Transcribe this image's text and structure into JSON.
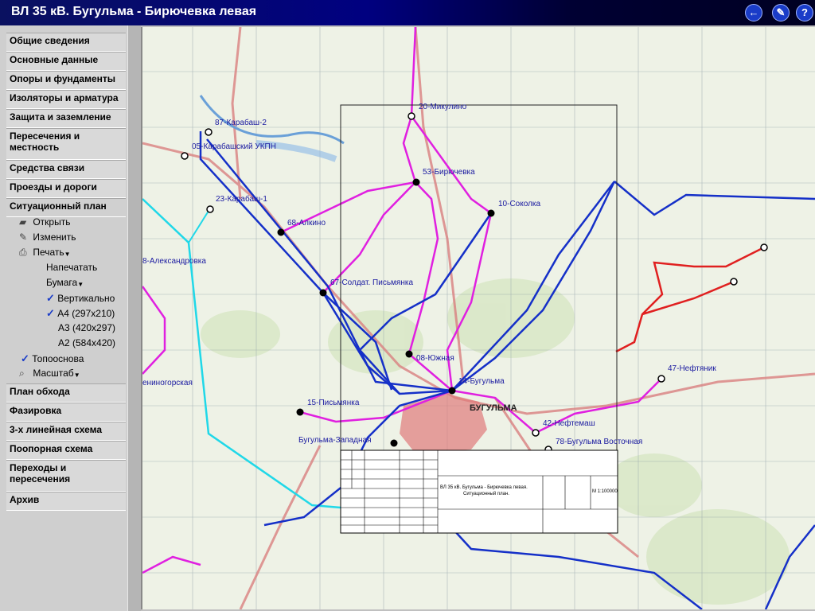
{
  "window": {
    "title": "ВЛ 35 кВ. Бугульма - Бирючевка левая"
  },
  "toolbar": {
    "back": "←",
    "edit": "✎",
    "help": "?"
  },
  "menu": {
    "items_top": [
      "Общие сведения",
      "Основные данные",
      "Опоры и фундаменты",
      "Изоляторы и арматура",
      "Защита и заземление",
      "Пересечения и местность",
      "Средства связи",
      "Проезды и дороги"
    ],
    "active": "Ситуационный план",
    "sub": {
      "open": "Открыть",
      "edit": "Изменить",
      "print": "Печать",
      "print_now": "Напечатать",
      "paper": "Бумага",
      "vertical": "Вертикально",
      "a4": "А4 (297x210)",
      "a3": "А3 (420x297)",
      "a2": "А2 (584x420)",
      "topobase": "Топооснова",
      "scale": "Масштаб"
    },
    "items_bottom": [
      "План обхода",
      "Фазировка",
      "3-х линейная схема",
      "Поопорная схема",
      "Переходы и пересечения",
      "Архив"
    ]
  },
  "map": {
    "labels": {
      "mikulino": "20-Микулино",
      "karabash2": "87-Карабаш-2",
      "karabash_ukpn": "05-Карабашский УКПН",
      "biryuchevka": "53-Бирючевка",
      "karabash1": "23-Карабаш-1",
      "sokolka": "10-Соколка",
      "alkino": "68-Алкино",
      "aleksandrovka": "8-Александровка",
      "soldat": "67-Солдат. Письмянка",
      "yuzhnaya": "08-Южная",
      "leninogorskaya": "ениногорская",
      "bugulma": "14-Бугульма",
      "neftyanik": "47-Нефтяник",
      "pismyanka": "15-Письмянка",
      "neftemash": "42-Нефтемаш",
      "bug_zap": "Бугульма-Западная",
      "bug_vost": "78-Бугульма Восточная",
      "town": "БУГУЛЬМА"
    },
    "stamp": {
      "title_line1": "ВЛ 35 кВ. Бугульма - Бирючевка левая.",
      "title_line2": "Ситуационный план.",
      "scale": "М 1:100000"
    }
  }
}
